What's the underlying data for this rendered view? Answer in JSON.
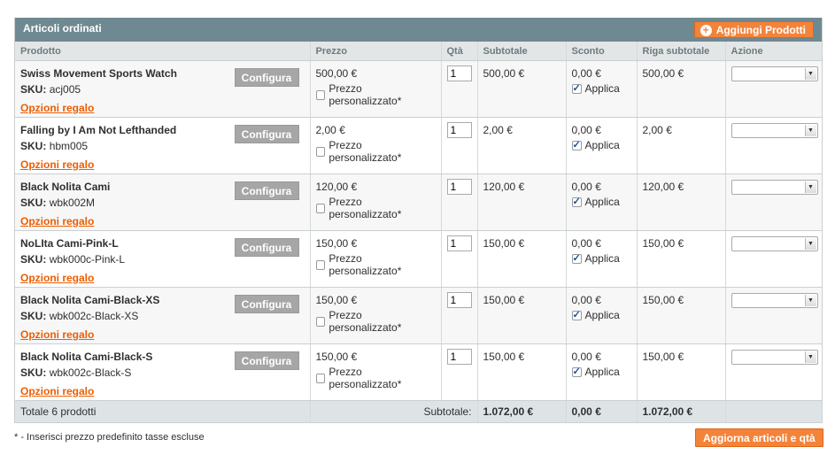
{
  "grid": {
    "title": "Articoli ordinati",
    "add_button": "Aggiungi Prodotti",
    "columns": [
      "Prodotto",
      "Prezzo",
      "Qtà",
      "Subtotale",
      "Sconto",
      "Riga subtotale",
      "Azione"
    ],
    "configure_label": "Configura",
    "gift_label": "Opzioni regalo",
    "sku_label": "SKU:",
    "custom_price_label": "Prezzo personalizzato*",
    "apply_label": "Applica",
    "items": [
      {
        "name": "Swiss Movement Sports Watch",
        "sku": "acj005",
        "price": "500,00 €",
        "qty": "1",
        "subtotal": "500,00 €",
        "discount": "0,00 €",
        "row_subtotal": "500,00 €"
      },
      {
        "name": "Falling by I Am Not Lefthanded",
        "sku": "hbm005",
        "price": "2,00 €",
        "qty": "1",
        "subtotal": "2,00 €",
        "discount": "0,00 €",
        "row_subtotal": "2,00 €"
      },
      {
        "name": "Black Nolita Cami",
        "sku": "wbk002M",
        "price": "120,00 €",
        "qty": "1",
        "subtotal": "120,00 €",
        "discount": "0,00 €",
        "row_subtotal": "120,00 €"
      },
      {
        "name": "NoLIta Cami-Pink-L",
        "sku": "wbk000c-Pink-L",
        "price": "150,00 €",
        "qty": "1",
        "subtotal": "150,00 €",
        "discount": "0,00 €",
        "row_subtotal": "150,00 €"
      },
      {
        "name": "Black Nolita Cami-Black-XS",
        "sku": "wbk002c-Black-XS",
        "price": "150,00 €",
        "qty": "1",
        "subtotal": "150,00 €",
        "discount": "0,00 €",
        "row_subtotal": "150,00 €"
      },
      {
        "name": "Black Nolita Cami-Black-S",
        "sku": "wbk002c-Black-S",
        "price": "150,00 €",
        "qty": "1",
        "subtotal": "150,00 €",
        "discount": "0,00 €",
        "row_subtotal": "150,00 €"
      }
    ],
    "totals": {
      "count_label": "Totale 6 prodotti",
      "subtotal_label": "Subtotale:",
      "subtotal": "1.072,00 €",
      "discount": "0,00 €",
      "row_subtotal": "1.072,00 €"
    }
  },
  "footer": {
    "note": "* - Inserisci prezzo predefinito tasse escluse",
    "update_button": "Aggiorna articoli e qtà"
  },
  "colors": {
    "header_bg": "#6f8992",
    "accent": "#f4833a",
    "link": "#eb5e00"
  }
}
